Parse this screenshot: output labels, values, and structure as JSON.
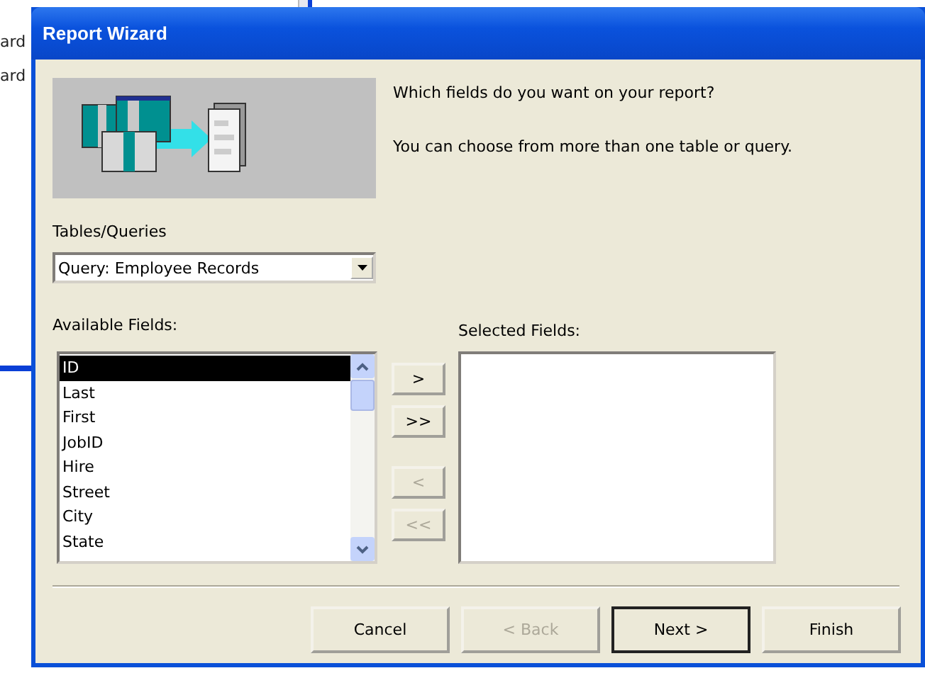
{
  "background_window": {
    "items": [
      "ard",
      "ard"
    ]
  },
  "window": {
    "title": "Report Wizard"
  },
  "intro": [
    "Which fields do you want on your report?",
    "You can choose from more than one table or query."
  ],
  "tables_queries": {
    "label": "Tables/Queries",
    "value": "Query: Employee Records"
  },
  "available_fields": {
    "label": "Available Fields:",
    "items": [
      {
        "label": "ID",
        "selected": true
      },
      {
        "label": "Last",
        "selected": false
      },
      {
        "label": "First",
        "selected": false
      },
      {
        "label": "JobID",
        "selected": false
      },
      {
        "label": "Hire",
        "selected": false
      },
      {
        "label": "Street",
        "selected": false
      },
      {
        "label": "City",
        "selected": false
      },
      {
        "label": "State",
        "selected": false
      }
    ]
  },
  "move_buttons": [
    {
      "label": ">",
      "disabled": false
    },
    {
      "label": ">>",
      "disabled": false
    },
    {
      "label": "<",
      "disabled": true
    },
    {
      "label": "<<",
      "disabled": true
    }
  ],
  "selected_fields": {
    "label": "Selected Fields:"
  },
  "buttons": [
    {
      "label": "Cancel",
      "disabled": false,
      "default": false
    },
    {
      "label": "< Back",
      "disabled": true,
      "default": false
    },
    {
      "label": "Next >",
      "disabled": false,
      "default": true
    },
    {
      "label": "Finish",
      "disabled": false,
      "default": false
    }
  ]
}
